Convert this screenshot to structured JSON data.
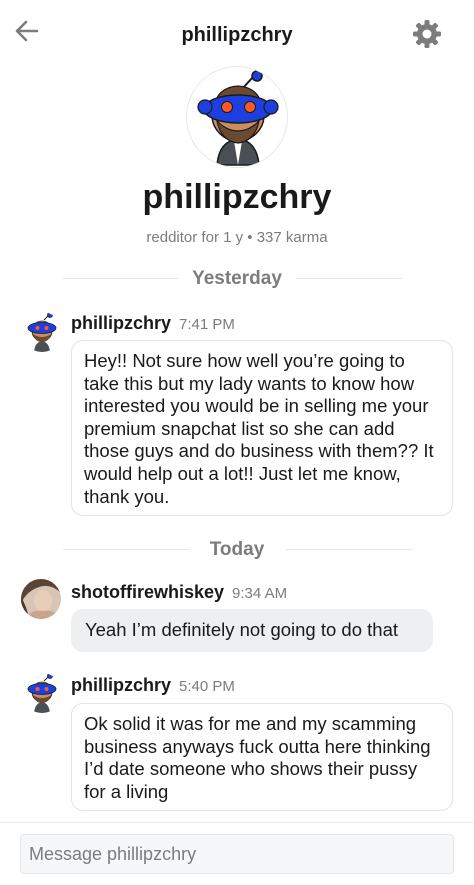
{
  "header": {
    "title": "phillipzchry",
    "back_icon": "back-arrow-icon",
    "settings_icon": "gear-icon"
  },
  "profile": {
    "name": "phillipzchry",
    "meta": "redditor for 1 y • 337 karma"
  },
  "dividers": {
    "yesterday": "Yesterday",
    "today": "Today"
  },
  "messages": [
    {
      "sender": "phillipzchry",
      "time": "7:41 PM",
      "text": "Hey!! Not sure how well you’re going to take this but my lady wants to know how interested you would be in selling me your premium snapchat list so she can add those guys and do business with them?? It would help out a lot!! Just let me know, thank you."
    },
    {
      "sender": "shotoffirewhiskey",
      "time": "9:34 AM",
      "text": "Yeah I’m definitely not going to do that"
    },
    {
      "sender": "phillipzchry",
      "time": "5:40 PM",
      "text": "Ok solid it was for me and my scamming business anyways fuck outta here thinking I’d date someone who shows their pussy for a living"
    }
  ],
  "composer": {
    "placeholder": "Message phillipzchry"
  },
  "colors": {
    "snoo_blue": "#1d3fe0",
    "snoo_eye": "#ff5a1f",
    "muted_text": "#7c7c7c",
    "bubble_gray": "#edeff1"
  }
}
